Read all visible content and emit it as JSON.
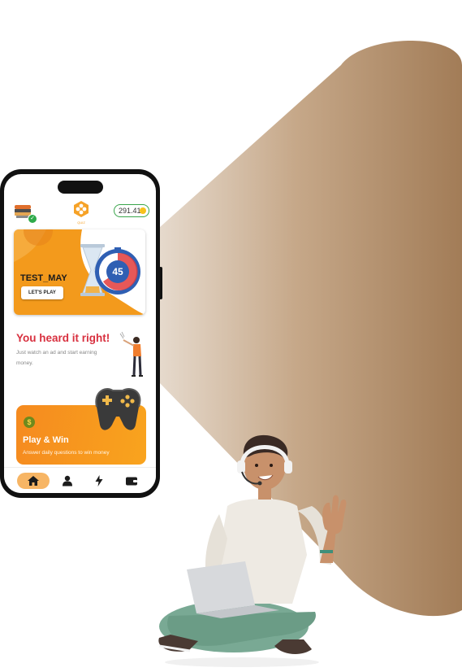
{
  "app": {
    "logo_label": "QUIZ",
    "coin_balance": "291.41",
    "accent_color": "#f6a227",
    "brand_gradient": [
      "#e0d2c2",
      "#a27c57"
    ]
  },
  "banner": {
    "title": "TEST_MAY",
    "button_label": "LET'S PLAY",
    "timer_value": "45",
    "active_slide": 1,
    "slide_count": 3
  },
  "promo": {
    "heading": "You heard it right!",
    "text": "Just watch an ad and start earning money."
  },
  "play_card": {
    "icon": "dollar-coin-icon",
    "title": "Play & Win",
    "subtitle": "Answer daily questions to win money"
  },
  "nav": {
    "items": [
      {
        "icon": "home-icon",
        "active": true
      },
      {
        "icon": "user-icon",
        "active": false
      },
      {
        "icon": "lightning-icon",
        "active": false
      },
      {
        "icon": "wallet-icon",
        "active": false
      }
    ]
  }
}
